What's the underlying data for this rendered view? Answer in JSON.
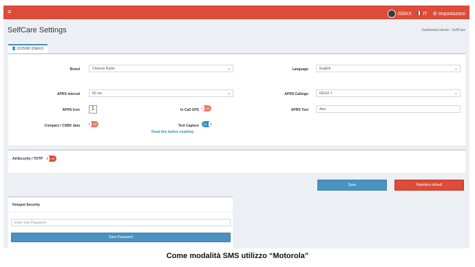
{
  "topbar": {
    "menu_icon": "hamburger-icon",
    "user": "ISEKX",
    "lang": "IT",
    "settings": "Impostazioni",
    "color": "#dd4b39"
  },
  "header": {
    "title": "SelfCare Settings",
    "breadcrumb": "Dashboard utente  ›  SelfCare"
  },
  "tab": {
    "label": "2225090 (ISEKX)"
  },
  "form": {
    "brand_label": "Brand",
    "brand_value": "Chinese Radio",
    "language_label": "Language",
    "language_value": "English",
    "aprs_interval_label": "APRS Interval",
    "aprs_interval_value": "60 sec",
    "aprs_callsign_label": "APRS Callsign",
    "aprs_callsign_value": "I5EKX-7",
    "aprs_icon_label": "APRS Icon",
    "aprs_icon_glyph": "🏃",
    "in_call_gps_label": "In Call GPS",
    "in_call_gps_state": "Off",
    "aprs_text_label": "APRS Text",
    "aprs_text_value": "Alex",
    "compact_label": "Compact / CSBK data",
    "compact_state": "Off",
    "text_capture_label": "Text Capture",
    "text_capture_state": "On",
    "read_link": "Read this before enabling"
  },
  "airsecurity": {
    "label": "AirSecurity / TOTP",
    "state": "Off"
  },
  "actions": {
    "save": "Save",
    "reset": "Ripristino default"
  },
  "hotspot": {
    "title": "Hotspot Security",
    "password_placeholder": "Enter new Password",
    "save_password": "Save Password"
  },
  "caption": "Come modalità SMS utilizzo “Motorola”"
}
